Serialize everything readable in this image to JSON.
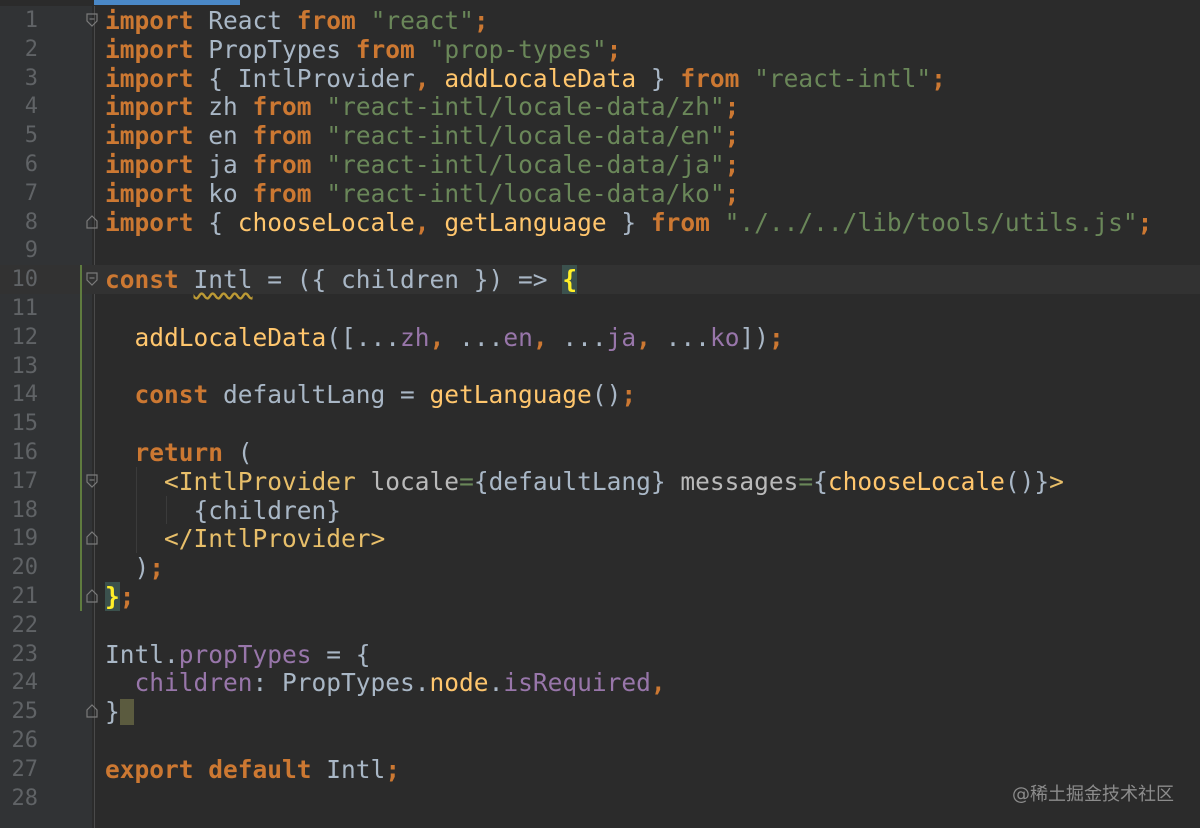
{
  "editor": {
    "lines": [
      {
        "n": "1",
        "tokens": [
          {
            "t": "kw",
            "v": "import"
          },
          {
            "t": "plain",
            "v": " React "
          },
          {
            "t": "kw",
            "v": "from"
          },
          {
            "t": "plain",
            "v": " "
          },
          {
            "t": "str",
            "v": "\"react\""
          },
          {
            "t": "kw",
            "v": ";"
          }
        ]
      },
      {
        "n": "2",
        "tokens": [
          {
            "t": "kw",
            "v": "import"
          },
          {
            "t": "plain",
            "v": " PropTypes "
          },
          {
            "t": "kw",
            "v": "from"
          },
          {
            "t": "plain",
            "v": " "
          },
          {
            "t": "str",
            "v": "\"prop-types\""
          },
          {
            "t": "kw",
            "v": ";"
          }
        ]
      },
      {
        "n": "3",
        "tokens": [
          {
            "t": "kw",
            "v": "import"
          },
          {
            "t": "plain",
            "v": " { IntlProvider"
          },
          {
            "t": "kw",
            "v": ","
          },
          {
            "t": "plain",
            "v": " "
          },
          {
            "t": "fn",
            "v": "addLocaleData"
          },
          {
            "t": "plain",
            "v": " } "
          },
          {
            "t": "kw",
            "v": "from"
          },
          {
            "t": "plain",
            "v": " "
          },
          {
            "t": "str",
            "v": "\"react-intl\""
          },
          {
            "t": "kw",
            "v": ";"
          }
        ]
      },
      {
        "n": "4",
        "tokens": [
          {
            "t": "kw",
            "v": "import"
          },
          {
            "t": "plain",
            "v": " zh "
          },
          {
            "t": "kw",
            "v": "from"
          },
          {
            "t": "plain",
            "v": " "
          },
          {
            "t": "str",
            "v": "\"react-intl/locale-data/zh\""
          },
          {
            "t": "kw",
            "v": ";"
          }
        ]
      },
      {
        "n": "5",
        "tokens": [
          {
            "t": "kw",
            "v": "import"
          },
          {
            "t": "plain",
            "v": " en "
          },
          {
            "t": "kw",
            "v": "from"
          },
          {
            "t": "plain",
            "v": " "
          },
          {
            "t": "str",
            "v": "\"react-intl/locale-data/en\""
          },
          {
            "t": "kw",
            "v": ";"
          }
        ]
      },
      {
        "n": "6",
        "tokens": [
          {
            "t": "kw",
            "v": "import"
          },
          {
            "t": "plain",
            "v": " ja "
          },
          {
            "t": "kw",
            "v": "from"
          },
          {
            "t": "plain",
            "v": " "
          },
          {
            "t": "str",
            "v": "\"react-intl/locale-data/ja\""
          },
          {
            "t": "kw",
            "v": ";"
          }
        ]
      },
      {
        "n": "7",
        "tokens": [
          {
            "t": "kw",
            "v": "import"
          },
          {
            "t": "plain",
            "v": " ko "
          },
          {
            "t": "kw",
            "v": "from"
          },
          {
            "t": "plain",
            "v": " "
          },
          {
            "t": "str",
            "v": "\"react-intl/locale-data/ko\""
          },
          {
            "t": "kw",
            "v": ";"
          }
        ]
      },
      {
        "n": "8",
        "tokens": [
          {
            "t": "kw",
            "v": "import"
          },
          {
            "t": "plain",
            "v": " { "
          },
          {
            "t": "fn",
            "v": "chooseLocale"
          },
          {
            "t": "kw",
            "v": ","
          },
          {
            "t": "plain",
            "v": " "
          },
          {
            "t": "fn",
            "v": "getLanguage"
          },
          {
            "t": "plain",
            "v": " } "
          },
          {
            "t": "kw",
            "v": "from"
          },
          {
            "t": "plain",
            "v": " "
          },
          {
            "t": "str",
            "v": "\"./../../lib/tools/utils.js\""
          },
          {
            "t": "kw",
            "v": ";"
          }
        ]
      },
      {
        "n": "9",
        "tokens": []
      },
      {
        "n": "10",
        "tokens": [
          {
            "t": "kw",
            "v": "const"
          },
          {
            "t": "plain",
            "v": " "
          },
          {
            "t": "squiggle",
            "v": "Intl"
          },
          {
            "t": "plain",
            "v": " = ({ children }) => "
          },
          {
            "t": "brace-hl",
            "v": "{"
          }
        ]
      },
      {
        "n": "11",
        "tokens": []
      },
      {
        "n": "12",
        "tokens": [
          {
            "t": "plain",
            "v": "  "
          },
          {
            "t": "fn",
            "v": "addLocaleData"
          },
          {
            "t": "plain",
            "v": "([..."
          },
          {
            "t": "prop",
            "v": "zh"
          },
          {
            "t": "kw",
            "v": ","
          },
          {
            "t": "plain",
            "v": " ..."
          },
          {
            "t": "prop",
            "v": "en"
          },
          {
            "t": "kw",
            "v": ","
          },
          {
            "t": "plain",
            "v": " ..."
          },
          {
            "t": "prop",
            "v": "ja"
          },
          {
            "t": "kw",
            "v": ","
          },
          {
            "t": "plain",
            "v": " ..."
          },
          {
            "t": "prop",
            "v": "ko"
          },
          {
            "t": "plain",
            "v": "])"
          },
          {
            "t": "kw",
            "v": ";"
          }
        ]
      },
      {
        "n": "13",
        "tokens": []
      },
      {
        "n": "14",
        "tokens": [
          {
            "t": "plain",
            "v": "  "
          },
          {
            "t": "kw",
            "v": "const"
          },
          {
            "t": "plain",
            "v": " defaultLang = "
          },
          {
            "t": "fn",
            "v": "getLanguage"
          },
          {
            "t": "plain",
            "v": "()"
          },
          {
            "t": "kw",
            "v": ";"
          }
        ]
      },
      {
        "n": "15",
        "tokens": []
      },
      {
        "n": "16",
        "tokens": [
          {
            "t": "plain",
            "v": "  "
          },
          {
            "t": "kw",
            "v": "return"
          },
          {
            "t": "plain",
            "v": " ("
          }
        ]
      },
      {
        "n": "17",
        "tokens": [
          {
            "t": "plain",
            "v": "    "
          },
          {
            "t": "tag",
            "v": "<IntlProvider"
          },
          {
            "t": "plain",
            "v": " "
          },
          {
            "t": "attr",
            "v": "locale"
          },
          {
            "t": "str",
            "v": "="
          },
          {
            "t": "plain",
            "v": "{defaultLang} "
          },
          {
            "t": "attr",
            "v": "messages"
          },
          {
            "t": "str",
            "v": "="
          },
          {
            "t": "plain",
            "v": "{"
          },
          {
            "t": "fn",
            "v": "chooseLocale"
          },
          {
            "t": "plain",
            "v": "()}"
          },
          {
            "t": "tag",
            "v": ">"
          }
        ]
      },
      {
        "n": "18",
        "tokens": [
          {
            "t": "plain",
            "v": "      {children}"
          }
        ]
      },
      {
        "n": "19",
        "tokens": [
          {
            "t": "plain",
            "v": "    "
          },
          {
            "t": "tag",
            "v": "</IntlProvider>"
          }
        ]
      },
      {
        "n": "20",
        "tokens": [
          {
            "t": "plain",
            "v": "  )"
          },
          {
            "t": "kw",
            "v": ";"
          }
        ]
      },
      {
        "n": "21",
        "tokens": [
          {
            "t": "brace-hl",
            "v": "}"
          },
          {
            "t": "kw",
            "v": ";"
          }
        ]
      },
      {
        "n": "22",
        "tokens": []
      },
      {
        "n": "23",
        "tokens": [
          {
            "t": "plain",
            "v": "Intl."
          },
          {
            "t": "prop",
            "v": "propTypes"
          },
          {
            "t": "plain",
            "v": " = {"
          }
        ]
      },
      {
        "n": "24",
        "tokens": [
          {
            "t": "plain",
            "v": "  "
          },
          {
            "t": "prop",
            "v": "children"
          },
          {
            "t": "plain",
            "v": ": PropTypes."
          },
          {
            "t": "fn",
            "v": "node"
          },
          {
            "t": "plain",
            "v": "."
          },
          {
            "t": "prop",
            "v": "isRequired"
          },
          {
            "t": "kw",
            "v": ","
          }
        ]
      },
      {
        "n": "25",
        "tokens": [
          {
            "t": "plain",
            "v": "}"
          },
          {
            "t": "caret",
            "v": ""
          }
        ]
      },
      {
        "n": "26",
        "tokens": []
      },
      {
        "n": "27",
        "tokens": [
          {
            "t": "kw",
            "v": "export"
          },
          {
            "t": "plain",
            "v": " "
          },
          {
            "t": "kw",
            "v": "default"
          },
          {
            "t": "plain",
            "v": " Intl"
          },
          {
            "t": "kw",
            "v": ";"
          }
        ]
      },
      {
        "n": "28",
        "tokens": []
      }
    ],
    "current_line": "10",
    "fold_markers": {
      "1": "open",
      "8": "close",
      "10": "open",
      "17": "open",
      "19": "close",
      "21": "close",
      "25": "close"
    }
  },
  "watermark": "@稀土掘金技术社区"
}
